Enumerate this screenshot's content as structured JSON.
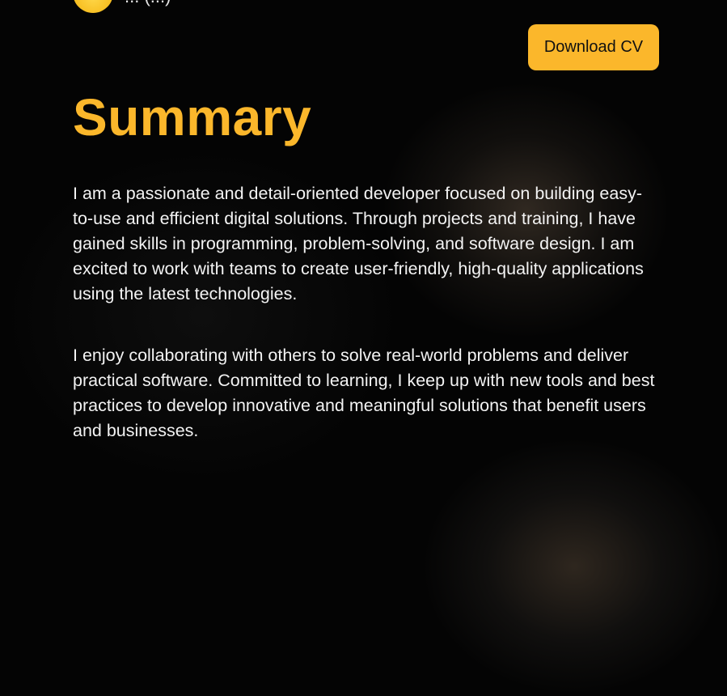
{
  "header": {
    "partial_text": "... (...)"
  },
  "actions": {
    "download_cv_label": "Download CV"
  },
  "summary": {
    "title": "Summary",
    "paragraphs": [
      "I am a passionate and detail-oriented developer focused on building easy-to-use and efficient digital solutions. Through projects and training, I have gained skills in programming, problem-solving, and software design. I am excited to work with teams to create user-friendly, high-quality applications using the latest technologies.",
      "I enjoy collaborating with others to solve real-world problems and deliver practical software. Committed to learning, I keep up with new tools and best practices to develop innovative and meaningful solutions that benefit users and businesses."
    ]
  },
  "colors": {
    "accent": "#fbb72b",
    "background": "#040404",
    "text": "#f3f3f3"
  }
}
